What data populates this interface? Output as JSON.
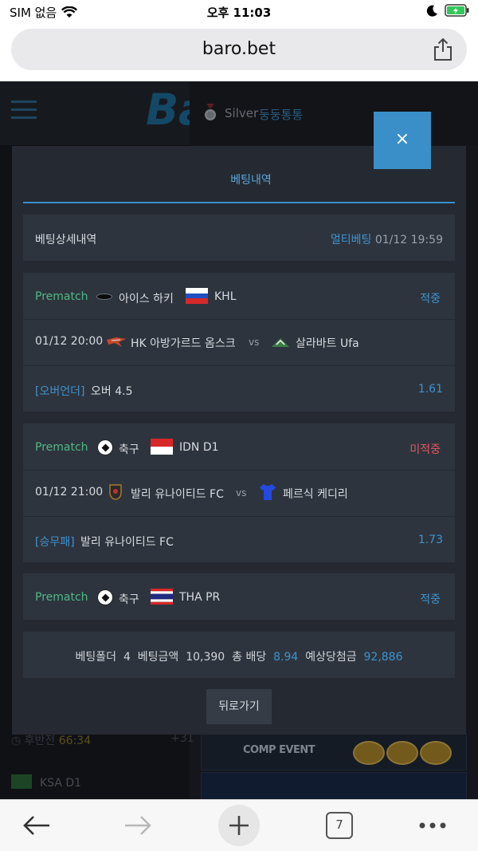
{
  "status_bar": {
    "carrier": "SIM 없음",
    "time": "오후 11:03"
  },
  "browser": {
    "url": "baro.bet",
    "tab_count": "7"
  },
  "site": {
    "logo": "Ba",
    "user_level": "Silver",
    "user_nick": "둥둥통통",
    "bg_timer_label": "후반전",
    "bg_timer_value": "66:34",
    "bg_plus": "+31",
    "bg_league": "KSA D1",
    "banner_text": "COMP EVENT"
  },
  "modal": {
    "title": "베팅내역",
    "close_label": "×",
    "detail_label": "베팅상세내역",
    "bet_type": "멀티베팅",
    "bet_datetime": "01/12 19:59",
    "bets": [
      {
        "category": "Prematch",
        "sport": "아이스 하키",
        "league": "KHL",
        "status": "적중",
        "match_time": "01/12 20:00",
        "home": "HK 아방가르드 옴스크",
        "vs": "vs",
        "away": "살라바트 Ufa",
        "market": "[오버언더]",
        "pick": "오버 4.5",
        "odds": "1.61"
      },
      {
        "category": "Prematch",
        "sport": "축구",
        "league": "IDN D1",
        "status": "미적중",
        "match_time": "01/12 21:00",
        "home": "발리 유나이티드 FC",
        "vs": "vs",
        "away": "페르식 케디리",
        "market": "[승무패]",
        "pick": "발리 유나이티드 FC",
        "odds": "1.73"
      },
      {
        "category": "Prematch",
        "sport": "축구",
        "league": "THA PR",
        "status": "적중"
      }
    ],
    "summary": {
      "folder_label": "베팅폴더",
      "folder_value": "4",
      "amount_label": "베팅금액",
      "amount_value": "10,390",
      "total_odds_label": "총 배당",
      "total_odds_value": "8.94",
      "expected_label": "예상당첨금",
      "expected_value": "92,886"
    },
    "back_label": "뒤로가기"
  },
  "colors": {
    "accent": "#3a8fc8",
    "win": "#3d93cf",
    "lose": "#e0585c",
    "prematch": "#4fb985"
  }
}
